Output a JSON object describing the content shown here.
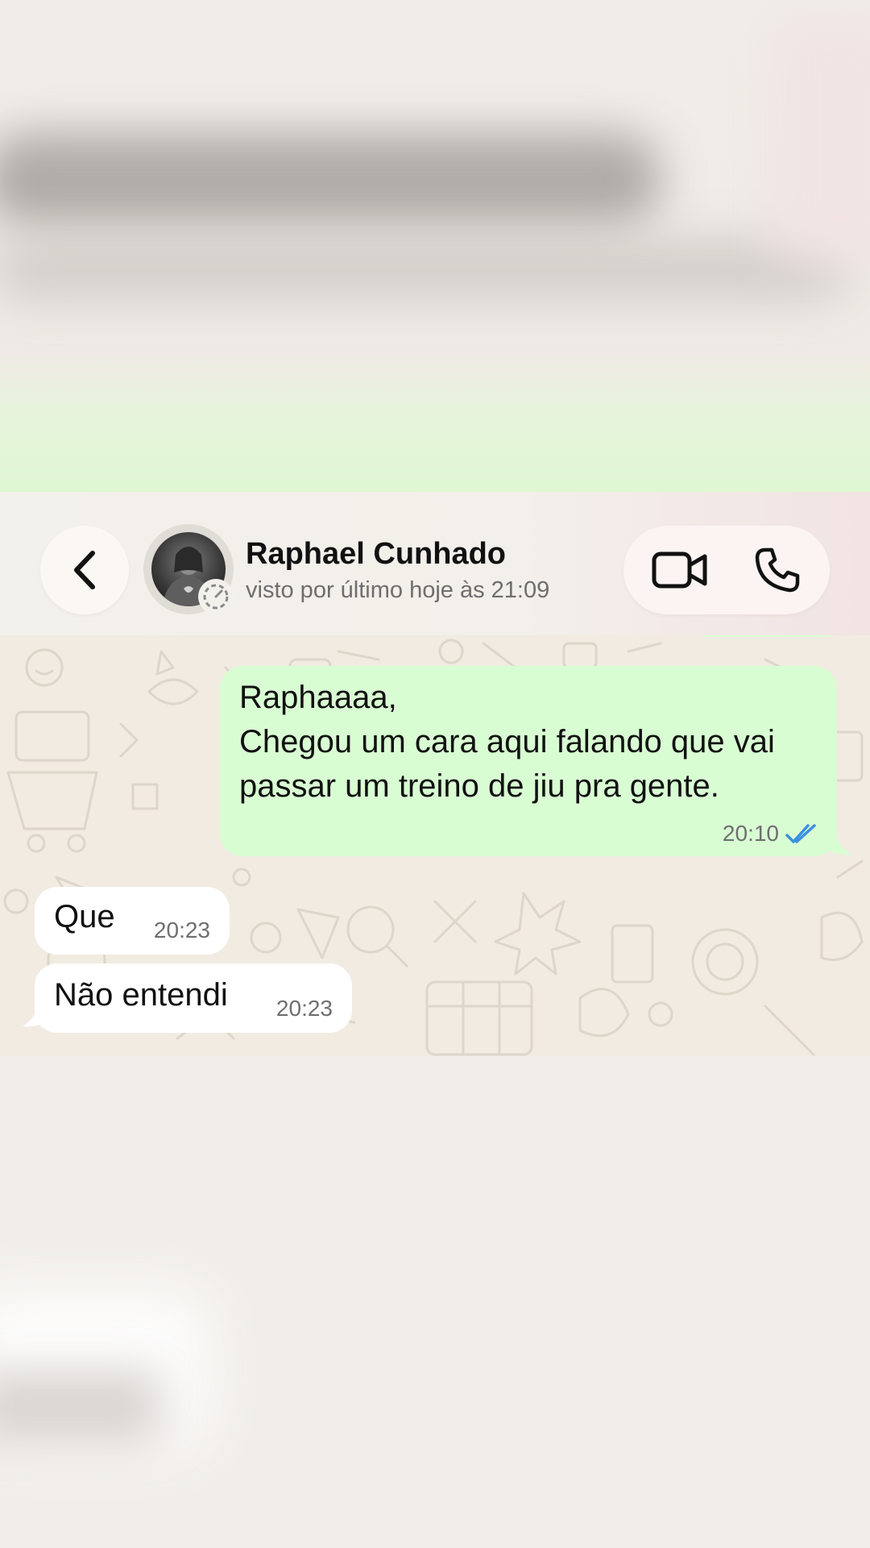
{
  "header": {
    "contact_name": "Raphael Cunhado",
    "contact_status": "visto por último hoje às 21:09"
  },
  "icons": {
    "back": "chevron-left-icon",
    "video": "video-camera-icon",
    "phone": "phone-icon",
    "status": "status-ring-icon",
    "read": "double-check-icon"
  },
  "messages": {
    "outgoing": {
      "text": "Raphaaaa,\nChegou um cara aqui falando que vai passar um treino de jiu pra gente.",
      "time": "20:10",
      "status": "read"
    },
    "incoming": [
      {
        "text": "Que",
        "time": "20:23"
      },
      {
        "text": "Não entendi",
        "time": "20:23"
      }
    ]
  },
  "colors": {
    "outgoing_bubble": "#d9fdd3",
    "incoming_bubble": "#ffffff",
    "read_check": "#3b8fe0",
    "chat_background": "#f1ebe1"
  }
}
